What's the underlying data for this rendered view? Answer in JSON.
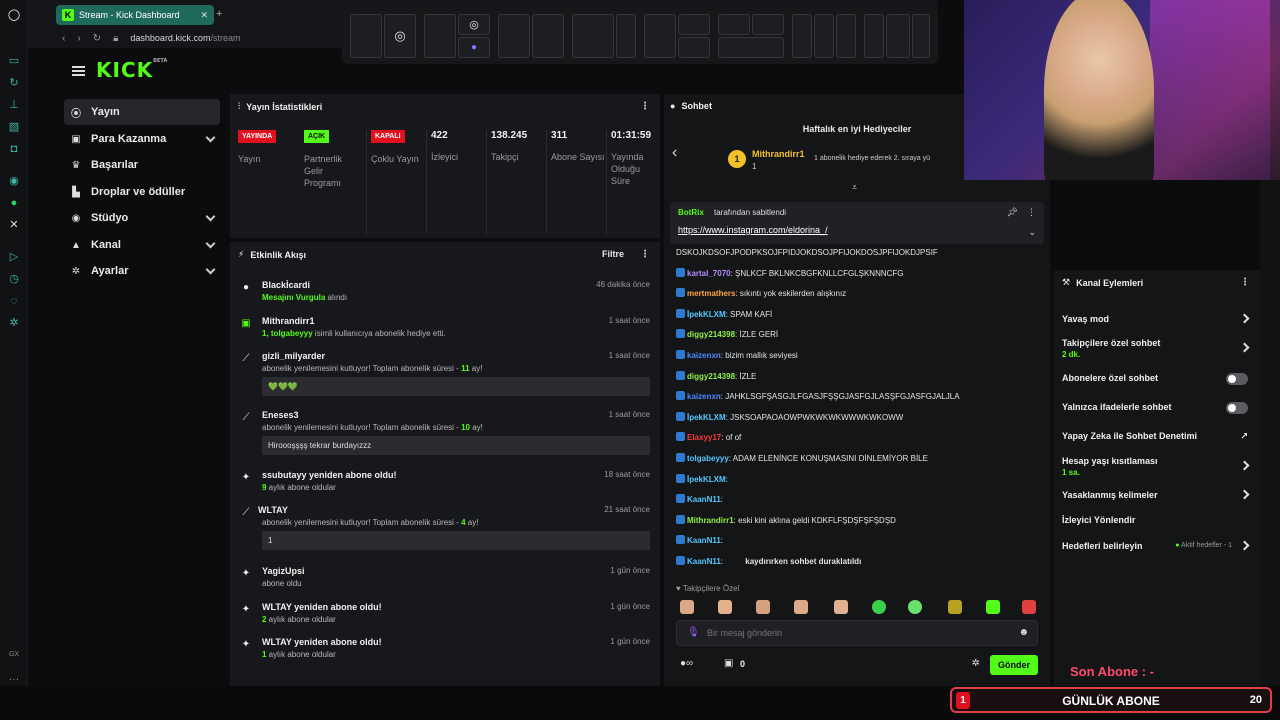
{
  "browser": {
    "tab_title": "Stream - Kick Dashboard",
    "url_host": "dashboard.kick.com",
    "url_path": "/stream"
  },
  "logo": {
    "text": "KICK",
    "beta": "BETA"
  },
  "nav": {
    "items": [
      {
        "label": "Yayın",
        "icon": "broadcast-icon"
      },
      {
        "label": "Para Kazanma",
        "icon": "dollar-icon"
      },
      {
        "label": "Başarılar",
        "icon": "trophy-icon"
      },
      {
        "label": "Droplar ve ödüller",
        "icon": "gift-icon"
      },
      {
        "label": "Stüdyo",
        "icon": "studio-icon"
      },
      {
        "label": "Kanal",
        "icon": "user-icon"
      },
      {
        "label": "Ayarlar",
        "icon": "gear-icon"
      }
    ]
  },
  "stats": {
    "title": "Yayın İstatistikleri",
    "cols": [
      {
        "badge": "YAYINDA",
        "label": "Yayın"
      },
      {
        "badge": "AÇIK",
        "label": "Partnerlik Gelir Programı"
      },
      {
        "badge": "KAPALI",
        "label": "Çoklu Yayın"
      },
      {
        "value": "422",
        "label": "İzleyici"
      },
      {
        "value": "138.245",
        "label": "Takipçi"
      },
      {
        "value": "311",
        "label": "Abone Sayısı"
      },
      {
        "value": "01:31:59",
        "label": "Yayında Olduğu Süre"
      }
    ]
  },
  "feed": {
    "title": "Etkinlik Akışı",
    "filter": "Filtre",
    "events": [
      {
        "name": "Blackİcardi",
        "time": "46 dakika önce",
        "hl": "Mesajını Vurgula",
        "sub": " alındı"
      },
      {
        "name": "Mithrandirr1",
        "time": "1 saat önce",
        "hl": "1, tolgabeyyy",
        "sub": " isimli kullanıcıya abonelik hediye etti."
      },
      {
        "name": "gizli_milyarder",
        "time": "1 saat önce",
        "sub": "abonelik yenilemesini kutluyor! Toplam abonelik süresi - ",
        "hl": "11",
        "sub2": " ay!",
        "box": "💚💚💚"
      },
      {
        "name": "Eneses3",
        "time": "1 saat önce",
        "sub": "abonelik yenilemesini kutluyor! Toplam abonelik süresi - ",
        "hl": "10",
        "sub2": " ay!",
        "box": "Hiroooşşşş tekrar burdayızzz"
      },
      {
        "name": "ssubutayy yeniden abone oldu!",
        "time": "18 saat önce",
        "hl": "9",
        "sub": " aylık abone oldular"
      },
      {
        "name": "WLTAY",
        "time": "21 saat önce",
        "sub": "abonelik yenilemesini kutluyor! Toplam abonelik süresi - ",
        "hl": "4",
        "sub2": " ay!",
        "box": "1"
      },
      {
        "name": "YagizUpsi",
        "time": "1 gün önce",
        "sub": "abone oldu"
      },
      {
        "name": "WLTAY yeniden abone oldu!",
        "time": "1 gün önce",
        "hl": "2",
        "sub": " aylık abone oldular"
      },
      {
        "name": "WLTAY yeniden abone oldu!",
        "time": "1 gün önce",
        "hl": "1",
        "sub": " aylık abone oldular"
      }
    ]
  },
  "chat": {
    "title": "Sohbet",
    "top_title": "Haftalık en iyi Hediyeciler",
    "top_user": "Mithrandirr1",
    "top_count": "1",
    "top_note": "1 abonelik hediye ederek 2. sıraya yü",
    "pinned_by": "BotRix",
    "pinned_suffix": " tarafından sabitlendi",
    "pinned_link": "https://www.instagram.com/eldorina_/",
    "messages": [
      {
        "user": "",
        "text": "DSKOJKDSOFJPODPKSOJFPIDJOKDSOJPFIJOKDOSJPFIJOKDJPSIF",
        "color": "#e4e4e4"
      },
      {
        "user": "kartal_7070",
        "text": ": ŞNLKCF BKLNKCBGFKNLLCFGLŞKNNNCFG",
        "color": "#b58cff"
      },
      {
        "user": "mertmathers",
        "text": ": sıkıntı yok eskilerden alışkınız",
        "color": "#ffa640"
      },
      {
        "user": "İpekKLXM",
        "text": ": SPAM KAFİ",
        "color": "#53c8ff"
      },
      {
        "user": "diggy214398",
        "text": ": İZLE GERİ",
        "color": "#8ef04a"
      },
      {
        "user": "kaizenxn",
        "text": ": bizim mallık seviyesi",
        "color": "#4a8aff"
      },
      {
        "user": "diggy214398",
        "text": ": İZLE",
        "color": "#8ef04a"
      },
      {
        "user": "kaizenxn",
        "text": ": JAHKLSGFŞASGJLFGASJFŞŞGJASFGJLASŞFGJASFGJALJLA",
        "color": "#4a8aff"
      },
      {
        "user": "İpekKLXM",
        "text": ": JSKSOAPAOAOWPWKWKWKWWWKWKOWW",
        "color": "#53c8ff"
      },
      {
        "user": "Elaxyy17",
        "text": ": of of",
        "color": "#ff3a3a"
      },
      {
        "user": "tolgabeyyy",
        "text": ": ADAM ELENİNCE KONUŞMASINI DİNLEMİYOR BİLE",
        "color": "#53c8ff"
      },
      {
        "user": "İpekKLXM",
        "text": ": ",
        "color": "#53c8ff"
      },
      {
        "user": "KaanN11",
        "text": ": ",
        "color": "#53c8ff"
      },
      {
        "user": "Mithrandirr1",
        "text": ": eski kini aklına geldi KDKFLFŞDŞFŞFŞDŞD",
        "color": "#8ef04a"
      },
      {
        "user": "KaanN11",
        "text": ": ",
        "color": "#53c8ff"
      },
      {
        "user": "KaanN11",
        "text": ": ",
        "color": "#53c8ff"
      }
    ],
    "paused": "kaydırırken sohbet duraklatıldı",
    "followers_only": "Takipçilere Özel",
    "placeholder": "Bir mesaj gönderin",
    "points": "0",
    "send": "Gönder"
  },
  "actions": {
    "title": "Kanal Eylemleri",
    "items": [
      {
        "label": "Yavaş mod",
        "kind": "arrow"
      },
      {
        "label": "Takipçilere özel sohbet",
        "sub": "2 dk.",
        "kind": "arrow"
      },
      {
        "label": "Abonelere özel sohbet",
        "kind": "toggle"
      },
      {
        "label": "Yalnızca ifadelerle sohbet",
        "kind": "toggle"
      },
      {
        "label": "Yapay Zeka ile Sohbet Denetimi",
        "kind": "ext"
      },
      {
        "label": "Hesap yaşı kısıtlaması",
        "sub": "1 sa.",
        "kind": "arrow"
      },
      {
        "label": "Yasaklanmış kelimeler",
        "kind": "arrow"
      },
      {
        "label": "İzleyici Yönlendir",
        "kind": "none"
      },
      {
        "label": "Hedefleri belirleyin",
        "note": "Aktif hedefler - 1",
        "kind": "arrow"
      }
    ]
  },
  "overlay": {
    "son_abone": "Son Abone : -",
    "daily_title": "GÜNLÜK ABONE",
    "daily_current": "1",
    "daily_goal": "20"
  },
  "colors": {
    "accent": "#53fc18",
    "red": "#e0101f"
  }
}
